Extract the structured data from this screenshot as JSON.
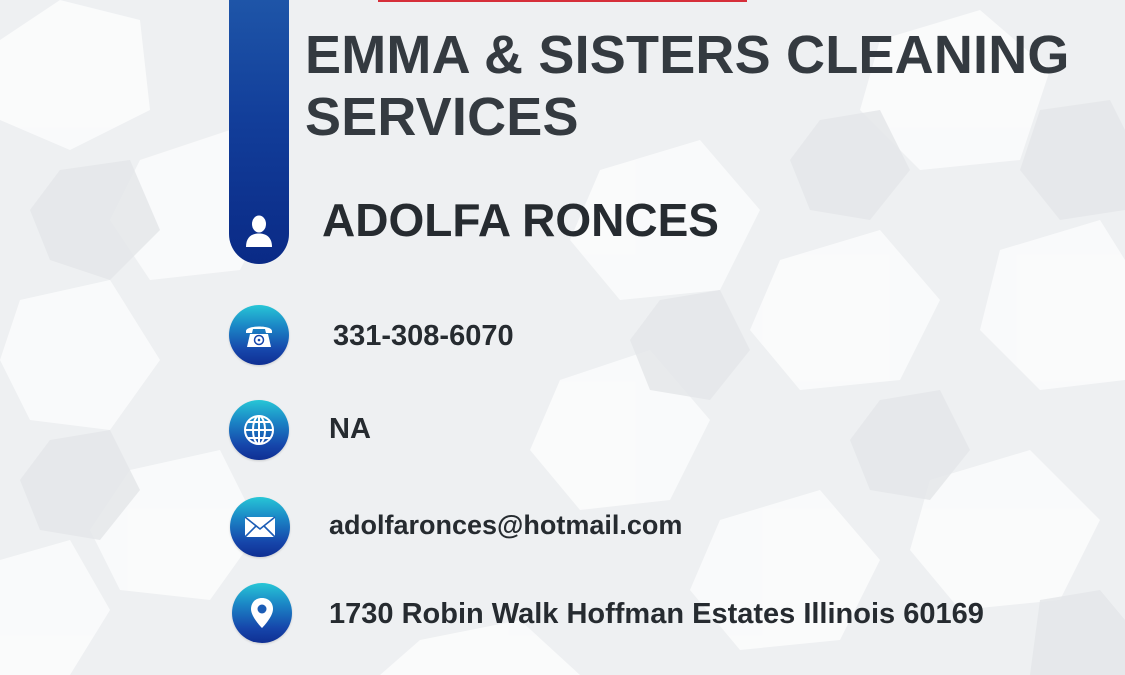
{
  "card": {
    "company": "EMMA & SISTERS CLEANING SERVICES",
    "person_name": "ADOLFA RONCES",
    "phone": "331-308-6070",
    "website": "NA",
    "email": "adolfaronces@hotmail.com",
    "address": "1730 Robin Walk Hoffman Estates Illinois 60169"
  },
  "colors": {
    "accent_blue": "#123e9a",
    "accent_cyan": "#27c6d6",
    "accent_red": "#d62f3a",
    "text_dark": "#262b30"
  },
  "icons": {
    "person": "person-icon",
    "phone": "phone-icon",
    "website": "globe-icon",
    "email": "envelope-icon",
    "address": "location-pin-icon"
  }
}
